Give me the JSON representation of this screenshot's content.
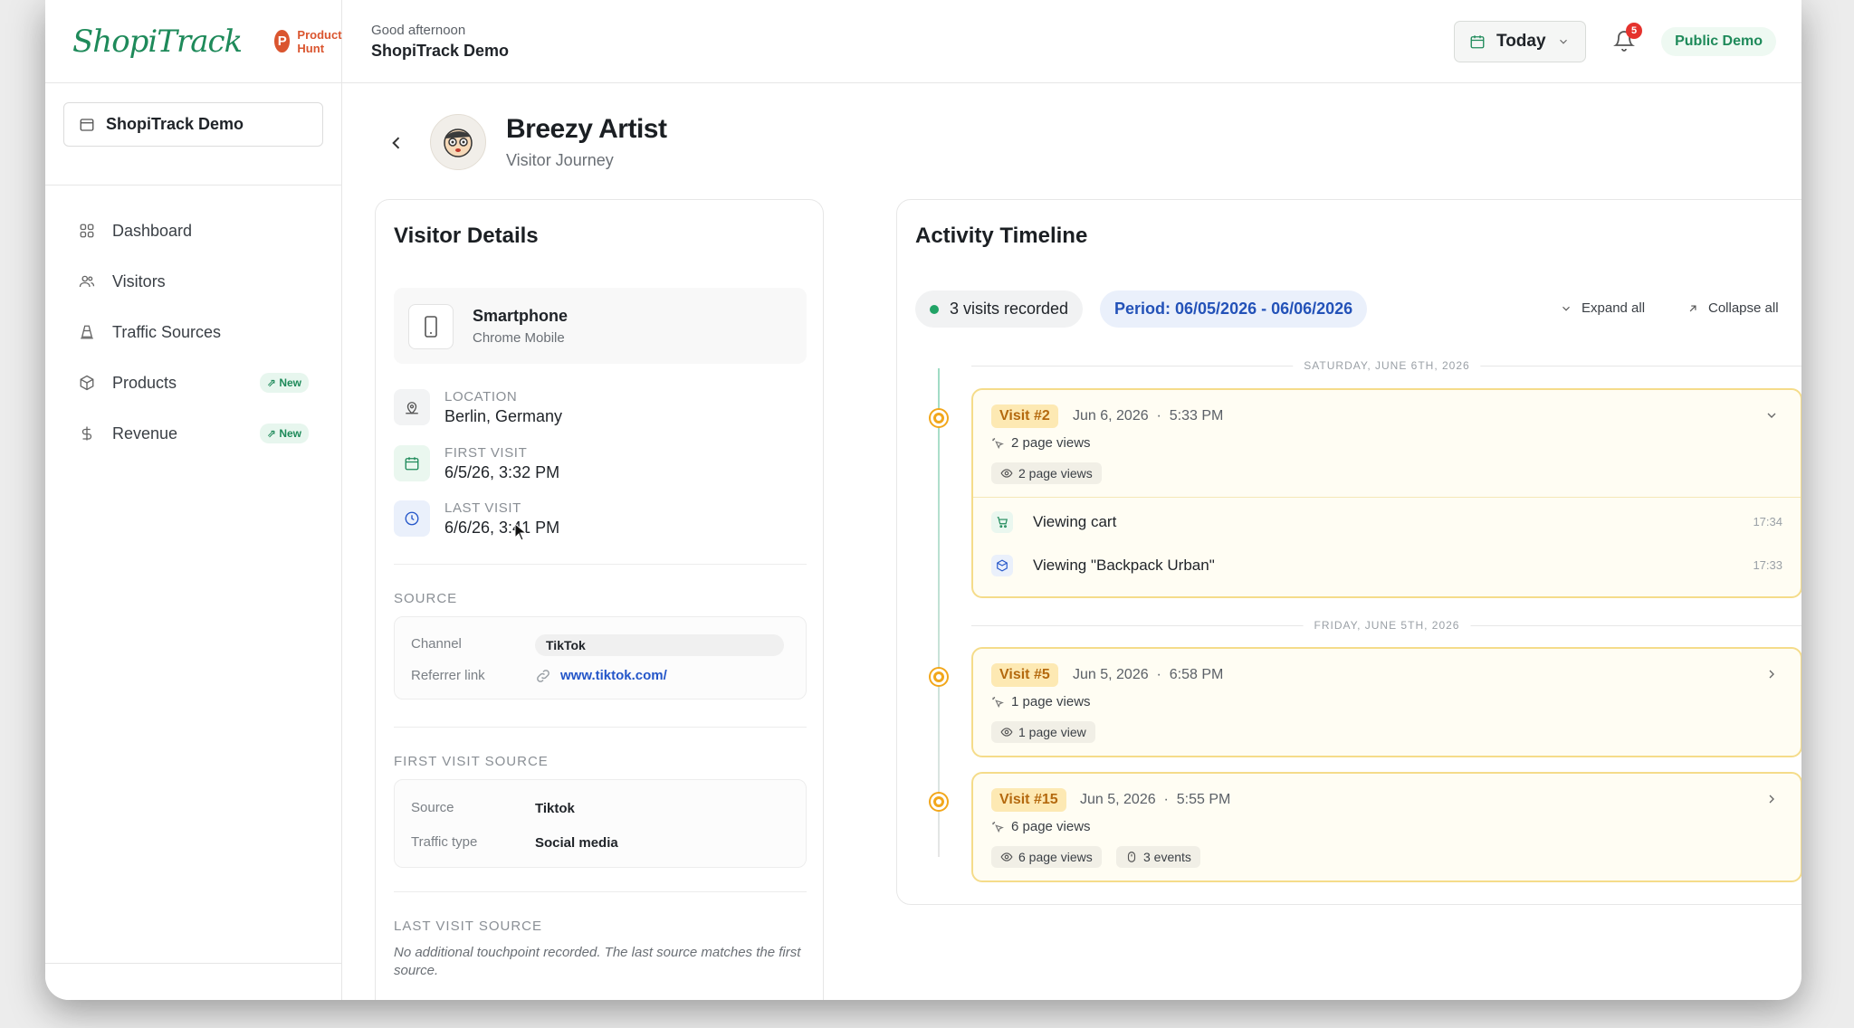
{
  "brand": {
    "logo_text": "ShopiTrack",
    "badge": "Product Hunt",
    "badge_letter": "P"
  },
  "store_selector": {
    "label": "ShopiTrack Demo"
  },
  "nav": {
    "items": [
      {
        "label": "Dashboard"
      },
      {
        "label": "Visitors"
      },
      {
        "label": "Traffic Sources"
      },
      {
        "label": "Products",
        "badge": "New"
      },
      {
        "label": "Revenue",
        "badge": "New"
      }
    ]
  },
  "topbar": {
    "greeting": "Good afternoon",
    "store_name": "ShopiTrack Demo",
    "date_filter": "Today",
    "notification_count": "5",
    "public_demo": "Public Demo"
  },
  "visitor": {
    "name": "Breezy Artist",
    "subtitle": "Visitor Journey"
  },
  "details": {
    "title": "Visitor Details",
    "device": {
      "name": "Smartphone",
      "browser": "Chrome Mobile"
    },
    "location": {
      "label": "LOCATION",
      "value": "Berlin, Germany"
    },
    "first_visit": {
      "label": "FIRST VISIT",
      "value": "6/5/26, 3:32 PM"
    },
    "last_visit": {
      "label": "LAST VISIT",
      "value": "6/6/26, 3:41 PM"
    },
    "source": {
      "section": "SOURCE",
      "channel_key": "Channel",
      "channel_val": "TikTok",
      "referrer_key": "Referrer link",
      "referrer_val": "www.tiktok.com/"
    },
    "first_visit_source": {
      "section": "FIRST VISIT SOURCE",
      "source_key": "Source",
      "source_val": "Tiktok",
      "type_key": "Traffic type",
      "type_val": "Social media"
    },
    "last_visit_source": {
      "section": "LAST VISIT SOURCE",
      "note": "No additional touchpoint recorded. The last source matches the first source."
    }
  },
  "timeline": {
    "title": "Activity Timeline",
    "visits_pill": "3 visits recorded",
    "period_pill": "Period: 06/05/2026 - 06/06/2026",
    "expand_all": "Expand all",
    "collapse_all": "Collapse all",
    "days": [
      "SATURDAY, JUNE 6TH, 2026",
      "FRIDAY, JUNE 5TH, 2026"
    ],
    "visits": [
      {
        "badge": "Visit #2",
        "date": "Jun 6, 2026",
        "time": "5:33 PM",
        "page_views": "2 page views",
        "tag": "2 page views",
        "events": [
          {
            "label": "Viewing cart",
            "time": "17:34"
          },
          {
            "label": "Viewing \"Backpack Urban\"",
            "time": "17:33"
          }
        ]
      },
      {
        "badge": "Visit #5",
        "date": "Jun 5, 2026",
        "time": "6:58 PM",
        "page_views": "1 page views",
        "tag": "1 page view"
      },
      {
        "badge": "Visit #15",
        "date": "Jun 5, 2026",
        "time": "5:55 PM",
        "page_views": "6 page views",
        "tag": "6 page views",
        "tag2": "3 events"
      }
    ]
  },
  "colors": {
    "brand_green": "#1e8a5a",
    "visit_orange": "#f2a71b",
    "link_blue": "#2456c9"
  }
}
